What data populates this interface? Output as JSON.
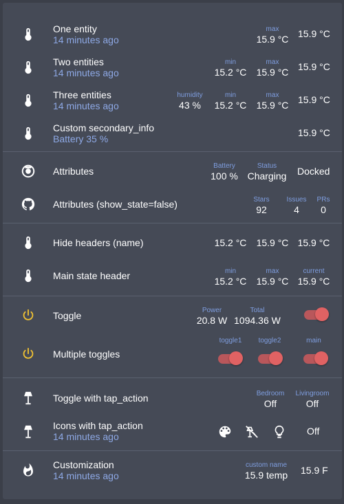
{
  "colors": {
    "background": "#3b3f49",
    "card": "#454a56",
    "secondary_text": "#8ea9e6",
    "label": "#7f9ee0",
    "toggle_on": "#e06263",
    "power_icon": "#f1c232"
  },
  "rows": {
    "one_entity": {
      "icon": "thermometer-icon",
      "name": "One entity",
      "secondary": "14 minutes ago",
      "c1_label": "max",
      "c1_value": "15.9 °C",
      "state": "15.9 °C"
    },
    "two_entities": {
      "icon": "thermometer-icon",
      "name": "Two entities",
      "secondary": "14 minutes ago",
      "c1_label": "min",
      "c1_value": "15.2 °C",
      "c2_label": "max",
      "c2_value": "15.9 °C",
      "state": "15.9 °C"
    },
    "three_entities": {
      "icon": "thermometer-icon",
      "name": "Three entities",
      "secondary": "14 minutes ago",
      "c1_label": "humidity",
      "c1_value": "43 %",
      "c2_label": "min",
      "c2_value": "15.2 °C",
      "c3_label": "max",
      "c3_value": "15.9 °C",
      "state": "15.9 °C"
    },
    "custom_secondary": {
      "icon": "thermometer-icon",
      "name": "Custom secondary_info",
      "secondary": "Battery 35 %",
      "state": "15.9 °C"
    },
    "attributes": {
      "icon": "robot-vacuum-icon",
      "name": "Attributes",
      "c1_label": "Battery",
      "c1_value": "100 %",
      "c2_label": "Status",
      "c2_value": "Charging",
      "state": "Docked"
    },
    "attributes_no_state": {
      "icon": "github-icon",
      "name": "Attributes (show_state=false)",
      "c1_label": "Stars",
      "c1_value": "92",
      "c2_label": "Issues",
      "c2_value": "4",
      "c3_label": "PRs",
      "c3_value": "0"
    },
    "hide_headers": {
      "icon": "thermometer-icon",
      "name": "Hide headers (name)",
      "v1": "15.2 °C",
      "v2": "15.9 °C",
      "v3": "15.9 °C"
    },
    "main_state_header": {
      "icon": "thermometer-icon",
      "name": "Main state header",
      "c1_label": "min",
      "c1_value": "15.2 °C",
      "c2_label": "max",
      "c2_value": "15.9 °C",
      "c3_label": "current",
      "c3_value": "15.9 °C"
    },
    "toggle": {
      "icon": "power-icon",
      "name": "Toggle",
      "c1_label": "Power",
      "c1_value": "20.8 W",
      "c2_label": "Total",
      "c2_value": "1094.36 W"
    },
    "multiple_toggles": {
      "icon": "power-icon",
      "name": "Multiple toggles",
      "t1_label": "toggle1",
      "t2_label": "toggle2",
      "t3_label": "main"
    },
    "toggle_tap": {
      "icon": "floor-lamp-icon",
      "name": "Toggle with tap_action",
      "c1_label": "Bedroom",
      "c1_value": "Off",
      "c2_label": "Livingroom",
      "c2_value": "Off"
    },
    "icons_tap": {
      "icon": "floor-lamp-icon",
      "name": "Icons with tap_action",
      "secondary": "14 minutes ago",
      "state": "Off"
    },
    "customization": {
      "icon": "fire-icon",
      "name": "Customization",
      "secondary": "14 minutes ago",
      "c1_label": "custom name",
      "c1_value": "15.9 temp",
      "state": "15.9 F"
    }
  }
}
